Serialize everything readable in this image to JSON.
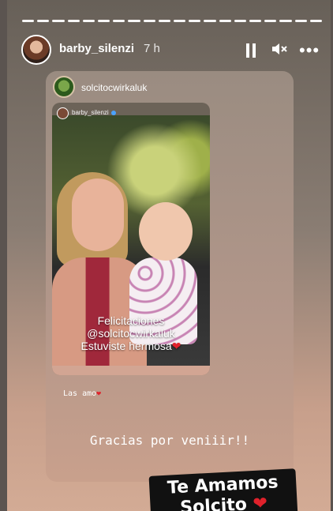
{
  "header": {
    "username": "barby_silenzi",
    "time": "7 h",
    "progress_segments": 20
  },
  "icons": {
    "pause": "pause-icon",
    "mute": "speaker-muted-icon",
    "more": "more-icon"
  },
  "repost": {
    "username": "solcitocwirkaluk",
    "photo": {
      "header_username": "barby_silenzi",
      "caption_line1": "Felicitaciones",
      "caption_line2": "@solcitocwirkaluk",
      "caption_line3": "Estuviste hermosa",
      "caption_heart": "❤"
    }
  },
  "captions": {
    "small": "Las amo",
    "small_heart": "❤",
    "thanks": "Gracias por veniiir!!"
  },
  "sticker": {
    "line1": "Te Amamos",
    "line2": "Solcito",
    "heart": "❤"
  },
  "colors": {
    "accent_heart": "#e0212b",
    "verified": "#4aa3ff"
  }
}
